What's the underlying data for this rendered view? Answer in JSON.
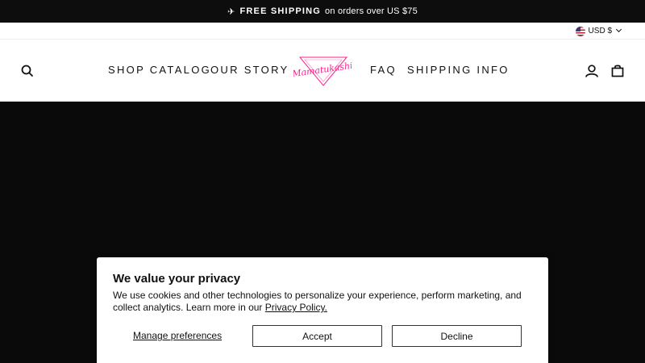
{
  "announcement": {
    "icon": "airplane-icon",
    "bold_text": "FREE SHIPPING",
    "text": "on orders over US $75"
  },
  "currency": {
    "label": "USD $",
    "flag_icon": "us-flag-icon"
  },
  "header": {
    "nav_left": [
      "SHOP CATALOG",
      "OUR STORY"
    ],
    "nav_right": [
      "FAQ",
      "SHIPPING INFO"
    ],
    "logo_text": "Mamatukashi",
    "logo_color": "#ff1f8e"
  },
  "cookie": {
    "title": "We value your privacy",
    "body": "We use cookies and other technologies to personalize your experience, perform marketing, and collect analytics. Learn more in our ",
    "link": "Privacy Policy.",
    "manage_label": "Manage preferences",
    "accept_label": "Accept",
    "decline_label": "Decline"
  },
  "colors": {
    "announcement_bg": "#0d0d0d",
    "hero_bg": "#0a0a0a",
    "brand_pink": "#ff1f8e"
  }
}
